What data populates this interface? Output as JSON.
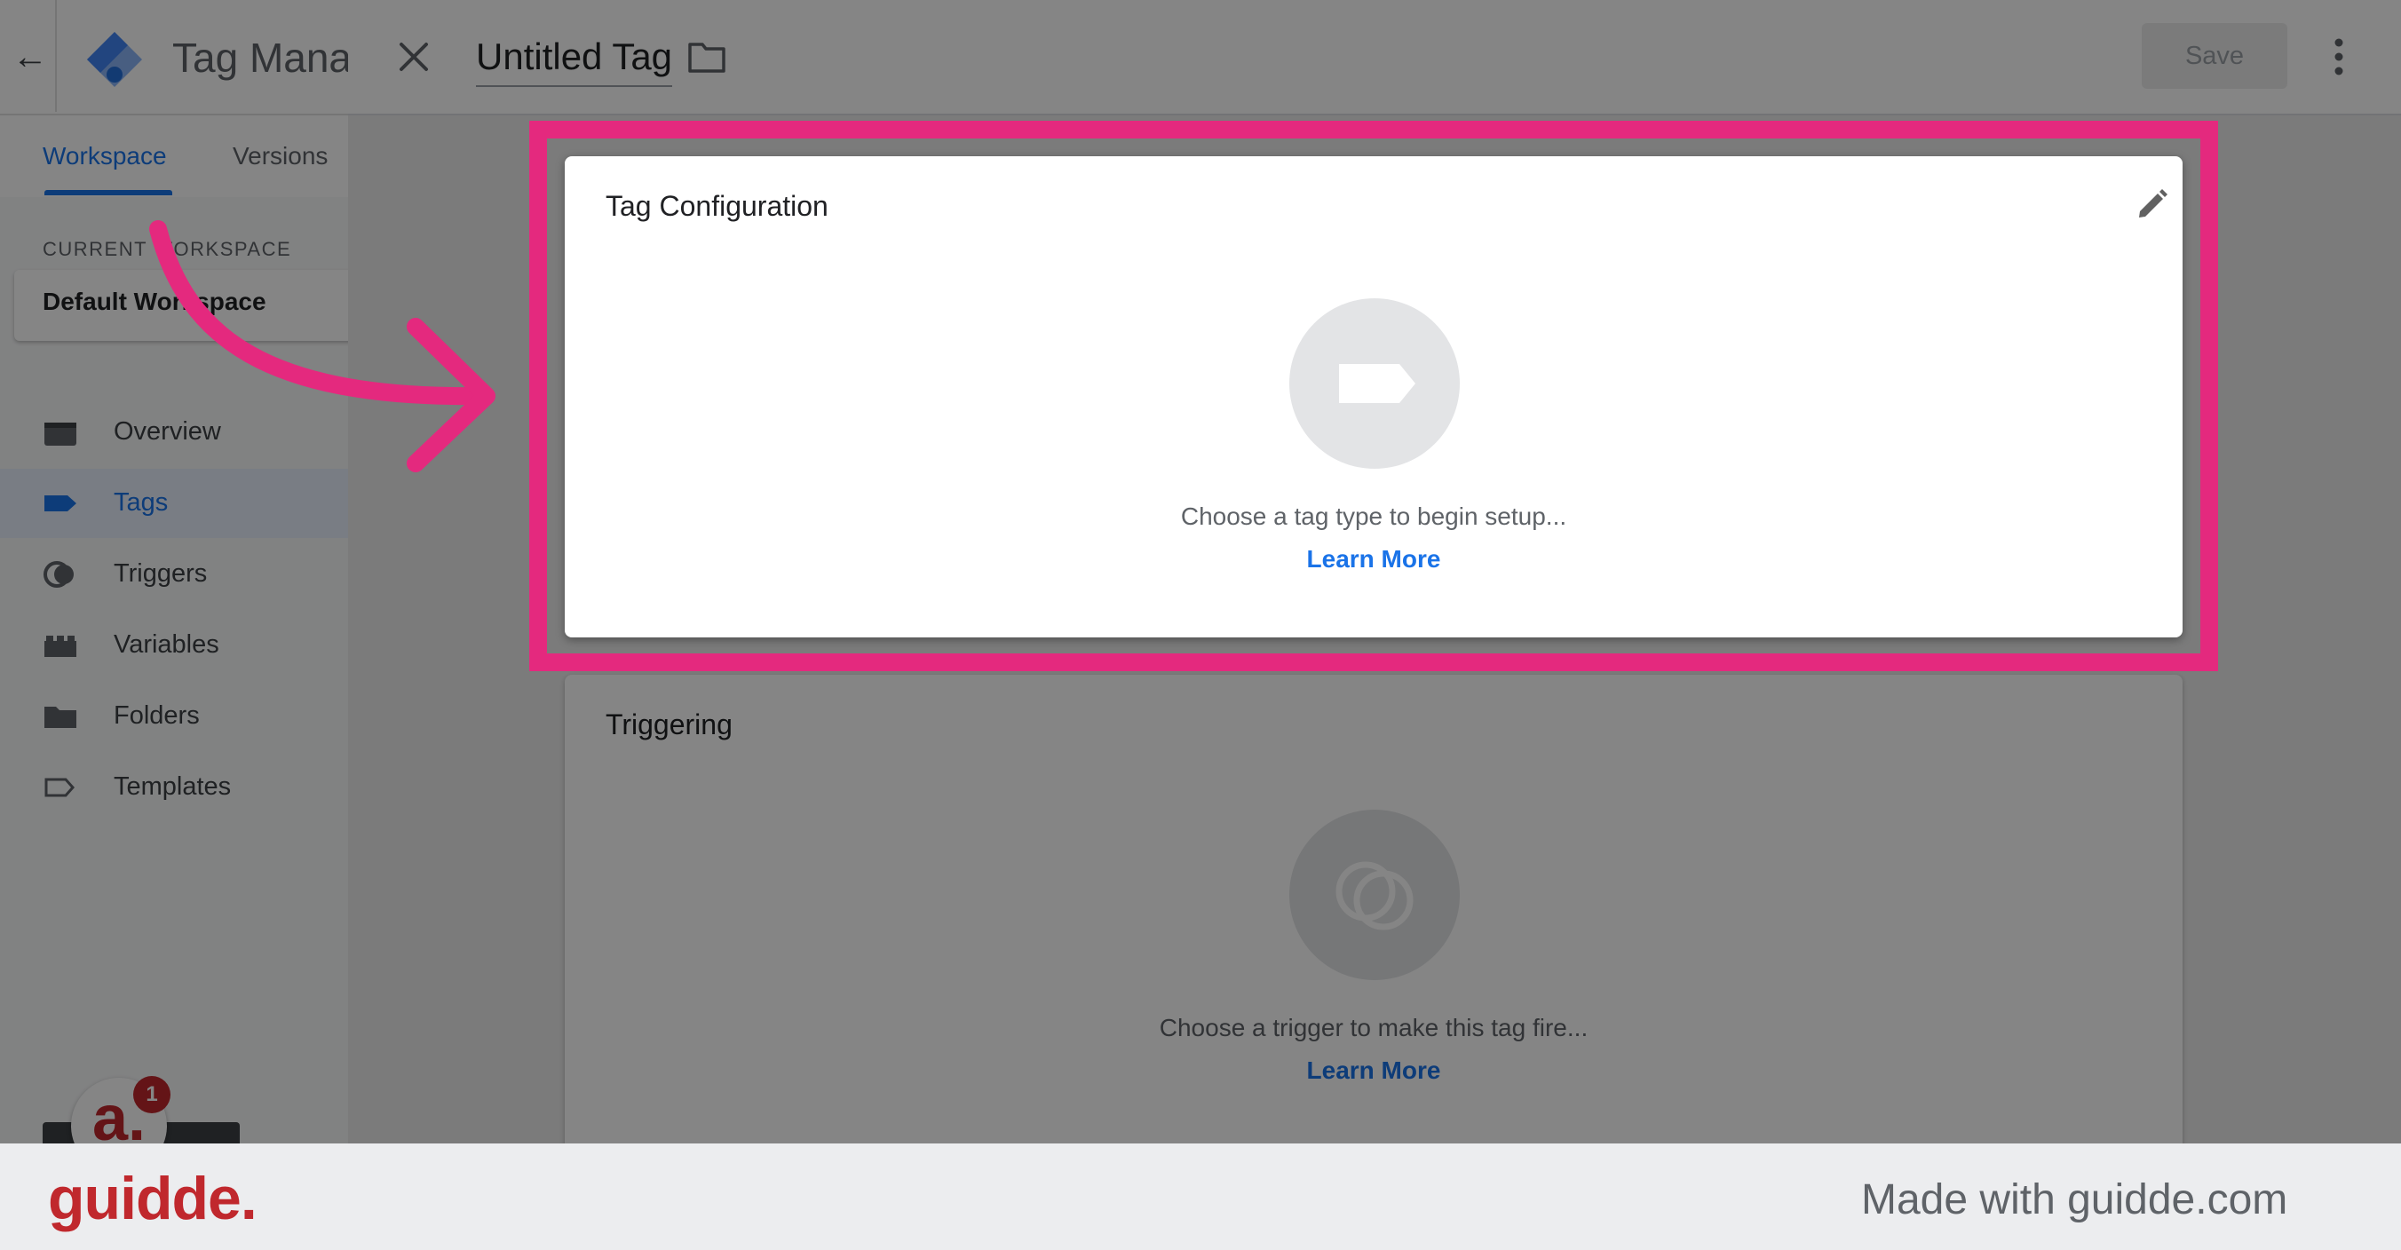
{
  "app": {
    "title": "Tag Manag",
    "tabs": [
      {
        "label": "Workspace"
      },
      {
        "label": "Versions"
      }
    ],
    "workspace_label": "CURRENT WORKSPACE",
    "workspace_name": "Default Workspace",
    "sidebar": [
      {
        "label": "Overview",
        "icon": "briefcase-icon"
      },
      {
        "label": "Tags",
        "icon": "tag-icon",
        "active": true
      },
      {
        "label": "Triggers",
        "icon": "trigger-icon"
      },
      {
        "label": "Variables",
        "icon": "variables-icon"
      },
      {
        "label": "Folders",
        "icon": "folder-icon"
      },
      {
        "label": "Templates",
        "icon": "template-icon"
      }
    ],
    "avatar_letter": "a.",
    "notification_count": "1"
  },
  "editor": {
    "tag_name": "Untitled Tag",
    "save_label": "Save",
    "config_card": {
      "title": "Tag Configuration",
      "hint": "Choose a tag type to begin setup...",
      "link": "Learn More"
    },
    "trigger_card": {
      "title": "Triggering",
      "hint": "Choose a trigger to make this tag fire...",
      "link": "Learn More"
    }
  },
  "footer": {
    "brand": "guidde.",
    "tagline": "Made with guidde.com"
  },
  "colors": {
    "highlight": "#e4297e",
    "brand_red": "#c0282d",
    "link_blue": "#1a73e8"
  }
}
